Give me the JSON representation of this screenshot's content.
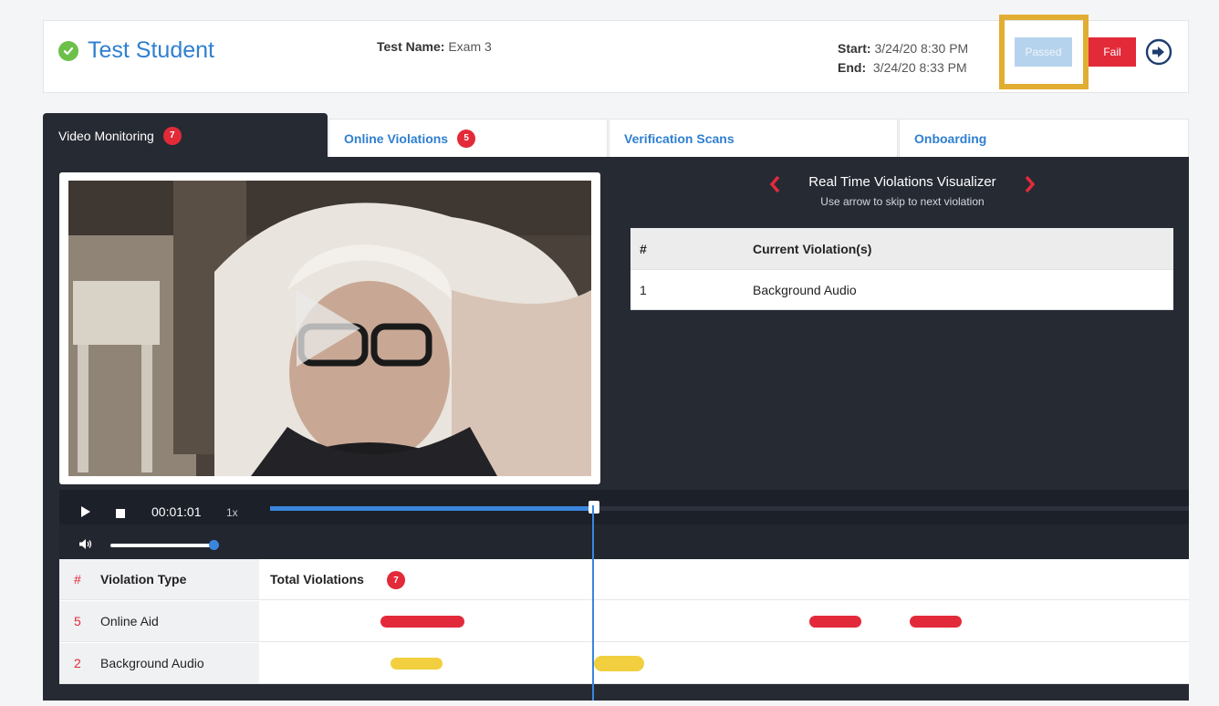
{
  "header": {
    "student_name": "Test Student",
    "test_name_label": "Test Name:",
    "test_name_value": "Exam 3",
    "start_label": "Start:",
    "start_value": "3/24/20 8:30 PM",
    "end_label": "End:",
    "end_value": "3/24/20 8:33 PM",
    "passed_label": "Passed",
    "fail_label": "Fail"
  },
  "tabs": [
    {
      "label": "Video Monitoring",
      "badge": "7"
    },
    {
      "label": "Online Violations",
      "badge": "5"
    },
    {
      "label": "Verification Scans"
    },
    {
      "label": "Onboarding"
    }
  ],
  "visualizer": {
    "title": "Real Time Violations Visualizer",
    "subtitle": "Use arrow to skip to next violation"
  },
  "current_table": {
    "headers": [
      "#",
      "Current Violation(s)"
    ],
    "rows": [
      [
        "1",
        "Background Audio"
      ]
    ]
  },
  "player": {
    "time": "00:01:01",
    "speed": "1x",
    "progress_fraction": 0.354,
    "volume_fraction": 0.95
  },
  "violations": {
    "header_num": "#",
    "header_type": "Violation Type",
    "header_total": "Total Violations",
    "total_badge": "7",
    "rows": [
      {
        "count": "5",
        "type": "Online Aid"
      },
      {
        "count": "2",
        "type": "Background Audio"
      }
    ]
  },
  "colors": {
    "accent_blue": "#2f7fd0",
    "violation_red": "#e22a3b",
    "violation_yellow": "#f1cf3e",
    "highlight_frame": "#e2ad33"
  }
}
